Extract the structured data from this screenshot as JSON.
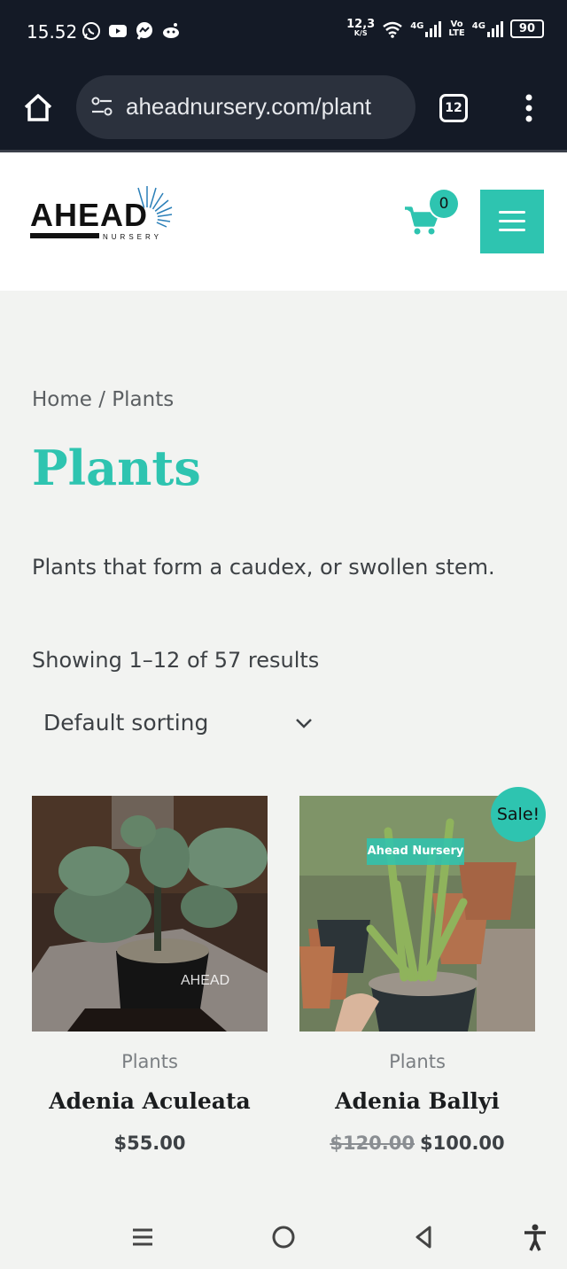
{
  "status_bar": {
    "time": "15.52",
    "speed_value": "12,3",
    "speed_unit": "K/S",
    "net1": "4G",
    "volte_top": "Vo",
    "volte_bottom": "LTE",
    "net2": "4G",
    "battery": "90",
    "icons": [
      "whatsapp-icon",
      "youtube-icon",
      "messenger-icon",
      "reddit-icon",
      "wifi-icon",
      "signal-icon",
      "battery-icon"
    ]
  },
  "browser": {
    "url": "aheadnursery.com/plant",
    "tab_count": "12",
    "icons": [
      "home-icon",
      "site-settings-icon",
      "tabs-icon",
      "more-vert-icon"
    ]
  },
  "header": {
    "logo_text": "AHEAD",
    "logo_sub": "NURSERY",
    "cart_count": "0",
    "accent": "#2ec4b0"
  },
  "breadcrumb": {
    "home": "Home",
    "separator": " / ",
    "current": "Plants"
  },
  "page": {
    "title": "Plants",
    "description": "Plants that form a caudex, or swollen stem.",
    "result_count": "Showing 1–12 of 57 results",
    "sorting_selected": "Default sorting"
  },
  "products": [
    {
      "category": "Plants",
      "name": "Adenia Aculeata",
      "price": "$55.00",
      "watermark": "AHEAD"
    },
    {
      "category": "Plants",
      "name": "Adenia Ballyi",
      "old_price": "$120.00",
      "price": "$100.00",
      "sale_badge": "Sale!",
      "watermark": "Ahead Nursery"
    }
  ],
  "nav_bar": {
    "icons": [
      "recent-apps-icon",
      "home-circle-icon",
      "back-icon",
      "accessibility-icon"
    ]
  }
}
